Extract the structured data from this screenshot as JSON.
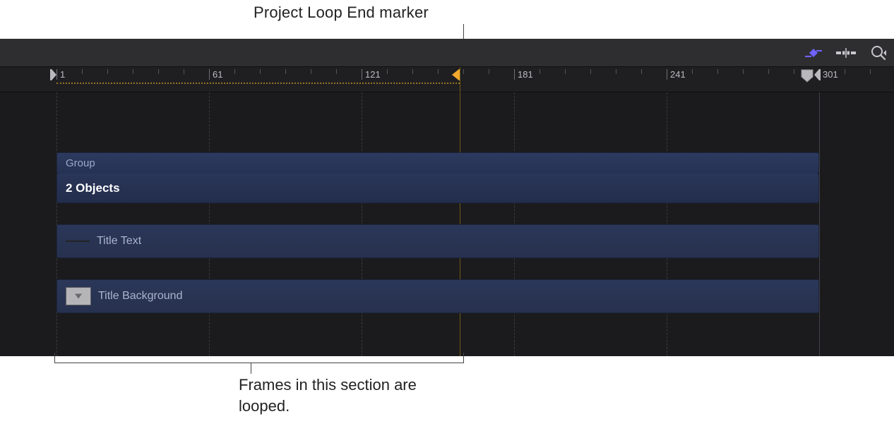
{
  "callouts": {
    "top": "Project Loop End marker",
    "bottom": "Frames in this section are looped."
  },
  "toolbar": {
    "keyframe_icon": "keyframe-curve",
    "snap_icon": "snapping",
    "zoom_icon": "zoom"
  },
  "ruler": {
    "labels": [
      "1",
      "61",
      "121",
      "181",
      "241",
      "301"
    ],
    "in_frame": 1,
    "loop_end_frame": 154,
    "out_frame": 301
  },
  "tracks": {
    "group": {
      "header_label": "Group",
      "summary_label": "2 Objects"
    },
    "items": [
      {
        "label": "Title Text",
        "kind": "text"
      },
      {
        "label": "Title Background",
        "kind": "image"
      }
    ]
  },
  "colors": {
    "loop_marker": "#f2a92e",
    "ruler_mark": "#b9b9bd",
    "track_fill": "#2b3759",
    "keyframe_icon": "#6f62ff"
  }
}
